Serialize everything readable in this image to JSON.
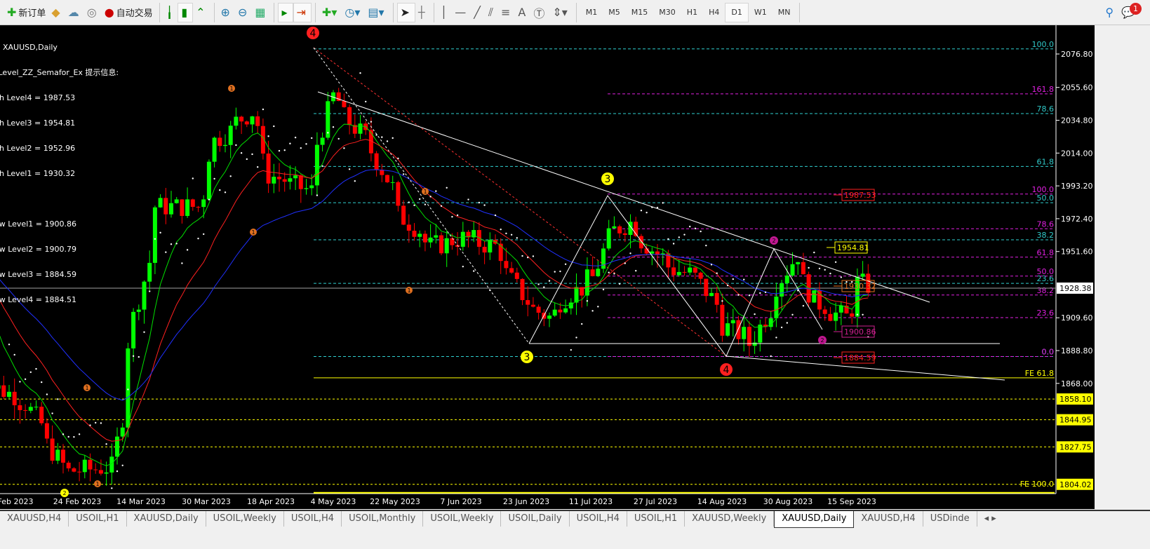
{
  "toolbar": {
    "new_order": "新订单",
    "auto_trade": "自动交易",
    "timeframes": [
      "M1",
      "M5",
      "M15",
      "M30",
      "H1",
      "H4",
      "D1",
      "W1",
      "MN"
    ],
    "active_timeframe": "D1",
    "notification_count": "1",
    "icons": [
      "new-order-icon",
      "market-watch-icon",
      "cloud-icon",
      "signal-icon",
      "auto-trading-icon",
      "bar-chart-icon",
      "candlestick-icon",
      "line-chart-icon",
      "zoom-in-icon",
      "zoom-out-icon",
      "tile-windows-icon",
      "auto-scroll-icon",
      "chart-shift-icon",
      "indicators-icon",
      "periods-icon",
      "templates-icon",
      "cursor-icon",
      "crosshair-icon",
      "vertical-line-icon",
      "horizontal-line-icon",
      "trendline-icon",
      "fibonacci-icon",
      "fibo-fan-icon",
      "text-icon",
      "text-label-icon",
      "arrows-icon",
      "search-icon",
      "chat-icon"
    ]
  },
  "chart": {
    "symbol": "XAUUSD,Daily",
    "indicator_title": "_Level_ZZ_Semafor_Ex 提示信息:",
    "high_levels": [
      "gh Level4 = 1987.53",
      "gh Level3 = 1954.81",
      "gh Level2 = 1952.96",
      "gh Level1 = 1930.32"
    ],
    "low_levels": [
      "ow Level1 = 1900.86",
      "ow Level2 = 1900.79",
      "ow Level3 = 1884.59",
      "ow Level4 = 1884.51"
    ],
    "current_price": "1928.38",
    "price_axis": [
      "2076.80",
      "2055.60",
      "2034.80",
      "2014.00",
      "1993.20",
      "1972.40",
      "1951.60",
      "1909.60",
      "1888.80",
      "1868.00"
    ],
    "highlighted_levels": [
      "1858.10",
      "1844.95",
      "1827.75",
      "1804.02"
    ],
    "date_axis": [
      "Feb 2023",
      "24 Feb 2023",
      "14 Mar 2023",
      "30 Mar 2023",
      "18 Apr 2023",
      "4 May 2023",
      "22 May 2023",
      "7 Jun 2023",
      "23 Jun 2023",
      "11 Jul 2023",
      "27 Jul 2023",
      "14 Aug 2023",
      "30 Aug 2023",
      "15 Sep 2023"
    ],
    "fib_cyan": [
      [
        "100.0",
        2080.0
      ],
      [
        "78.6",
        2039.0
      ],
      [
        "61.8",
        2005.5
      ],
      [
        "50.0",
        1982.5
      ],
      [
        "38.2",
        1959.0
      ],
      [
        "23.6",
        1931.4
      ],
      [
        "0.0",
        1885.0
      ]
    ],
    "fib_magenta": [
      [
        "161.8",
        2051.5
      ],
      [
        "100.0",
        1988.0
      ],
      [
        "78.6",
        1966.0
      ],
      [
        "61.8",
        1948.0
      ],
      [
        "50.0",
        1936.0
      ],
      [
        "38.2",
        1924.0
      ],
      [
        "23.6",
        1909.7
      ],
      [
        "0.0",
        1885.0
      ]
    ],
    "fe_levels": [
      [
        "FE 61.8",
        1871.5
      ],
      [
        "FE 100.0",
        1804.02
      ]
    ],
    "price_boxes": [
      [
        "1987.53",
        "#ff2020"
      ],
      [
        "1954.81",
        "#ffff00"
      ],
      [
        "1930.32",
        "#e07020"
      ],
      [
        "1900.86",
        "#d02090"
      ],
      [
        "1884.59",
        "#ff2020"
      ]
    ],
    "semafor": [
      [
        "4",
        "#ff2020"
      ],
      [
        "4",
        "#ff2020"
      ],
      [
        "3",
        "#ffff00"
      ],
      [
        "3",
        "#ffff00"
      ],
      [
        "2",
        "#c01890"
      ],
      [
        "2",
        "#c01890"
      ],
      [
        "2",
        "#ffff00"
      ],
      [
        "1",
        "#e07020"
      ],
      [
        "1",
        "#e07020"
      ],
      [
        "1",
        "#e07020"
      ],
      [
        "1",
        "#e07020"
      ],
      [
        "1",
        "#e07020"
      ],
      [
        "1",
        "#e07020"
      ]
    ]
  },
  "chart_data": {
    "type": "candlestick",
    "key_closes": [
      [
        "2023-02-01",
        1950
      ],
      [
        "2023-02-03",
        1870
      ],
      [
        "2023-02-14",
        1855
      ],
      [
        "2023-02-24",
        1812
      ],
      [
        "2023-03-08",
        1815
      ],
      [
        "2023-03-14",
        1910
      ],
      [
        "2023-03-20",
        1980
      ],
      [
        "2023-03-30",
        1980
      ],
      [
        "2023-04-04",
        2022
      ],
      [
        "2023-04-13",
        2040
      ],
      [
        "2023-04-18",
        2000
      ],
      [
        "2023-04-28",
        1990
      ],
      [
        "2023-05-04",
        2050
      ],
      [
        "2023-05-10",
        2030
      ],
      [
        "2023-05-15",
        2015
      ],
      [
        "2023-05-22",
        1975
      ],
      [
        "2023-05-30",
        1955
      ],
      [
        "2023-06-07",
        1960
      ],
      [
        "2023-06-15",
        1955
      ],
      [
        "2023-06-23",
        1920
      ],
      [
        "2023-06-29",
        1910
      ],
      [
        "2023-07-05",
        1925
      ],
      [
        "2023-07-11",
        1935
      ],
      [
        "2023-07-14",
        1960
      ],
      [
        "2023-07-20",
        1970
      ],
      [
        "2023-07-27",
        1950
      ],
      [
        "2023-08-01",
        1940
      ],
      [
        "2023-08-07",
        1935
      ],
      [
        "2023-08-14",
        1905
      ],
      [
        "2023-08-21",
        1893
      ],
      [
        "2023-08-25",
        1915
      ],
      [
        "2023-08-30",
        1940
      ],
      [
        "2023-09-01",
        1950
      ],
      [
        "2023-09-06",
        1920
      ],
      [
        "2023-09-12",
        1912
      ],
      [
        "2023-09-14",
        1910
      ],
      [
        "2023-09-18",
        1932
      ],
      [
        "2023-09-20",
        1930
      ]
    ],
    "up_color": "#00ff00",
    "down_color": "#ff0000"
  },
  "tabs": [
    "XAUUSD,H4",
    "USOIL,H1",
    "XAUUSD,Daily",
    "USOIL,Weekly",
    "USOIL,H4",
    "USOIL,Monthly",
    "USOIL,Weekly",
    "USOIL,Daily",
    "USOIL,H4",
    "USOIL,H1",
    "XAUUSD,Weekly",
    "XAUUSD,Daily",
    "XAUUSD,H4",
    "USDinde"
  ],
  "active_tab": "XAUUSD,Daily"
}
